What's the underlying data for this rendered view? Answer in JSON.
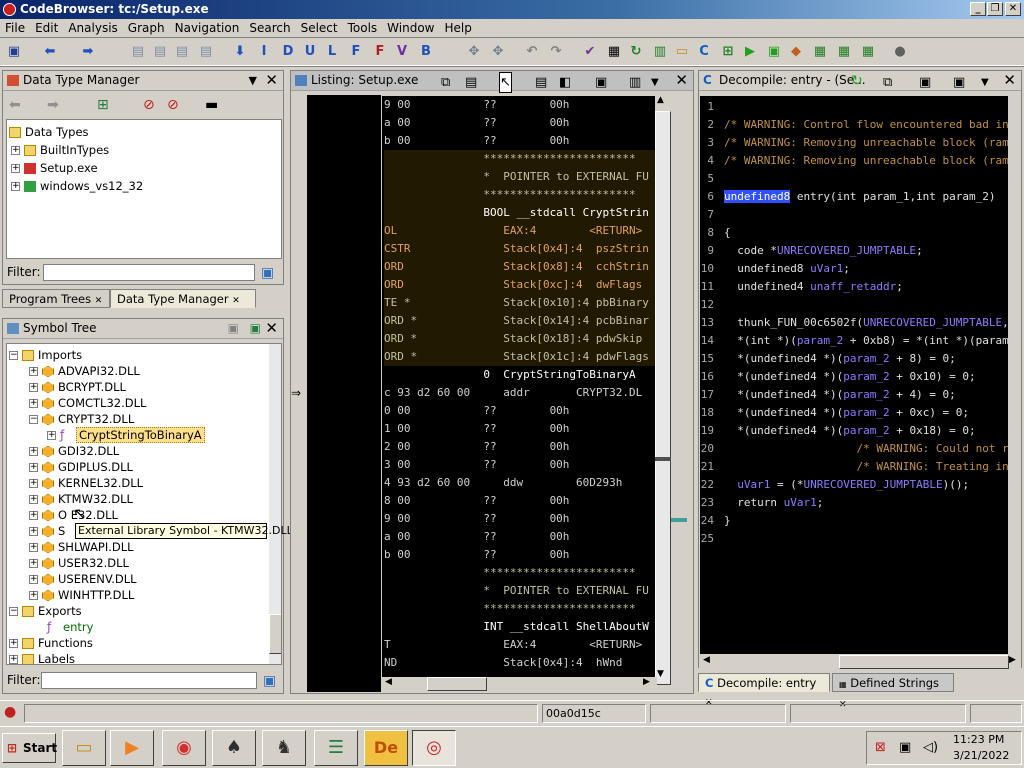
{
  "window": {
    "title": "CodeBrowser: tc:/Setup.exe"
  },
  "menu": [
    "File",
    "Edit",
    "Analysis",
    "Graph",
    "Navigation",
    "Search",
    "Select",
    "Tools",
    "Window",
    "Help"
  ],
  "dtm": {
    "title": "Data Type Manager",
    "root": "Data Types",
    "items": [
      "BuiltInTypes",
      "Setup.exe",
      "windows_vs12_32"
    ],
    "filter_label": "Filter:"
  },
  "left_tabs": [
    "Program Trees",
    "Data Type Manager"
  ],
  "symtree": {
    "title": "Symbol Tree",
    "imports": "Imports",
    "dlls": [
      "ADVAPI32.DLL",
      "BCRYPT.DLL",
      "COMCTL32.DLL",
      "CRYPT32.DLL",
      "GDI32.DLL",
      "GDIPLUS.DLL",
      "KERNEL32.DLL",
      "KTMW32.DLL",
      "OLE32.DLL",
      "S",
      "SHLWAPI.DLL",
      "USER32.DLL",
      "USERENV.DLL",
      "WINHTTP.DLL"
    ],
    "selected_fn": "CryptStringToBinaryA",
    "exports": "Exports",
    "entry": "entry",
    "functions": "Functions",
    "labels": "Labels",
    "filter_label": "Filter:",
    "tooltip": "External Library Symbol - KTMW32.DLL",
    "ole_visible": "O  E32.DLL"
  },
  "listing": {
    "title": "Listing:  Setup.exe",
    "lines": [
      "9 00           ??        00h",
      "a 00           ??        00h",
      "b 00           ??        00h",
      "               ***********************",
      "               *  POINTER to EXTERNAL FU",
      "               ***********************",
      "               BOOL __stdcall CryptStrin",
      "OL                EAX:4        <RETURN>",
      "CSTR              Stack[0x4]:4  pszStrin",
      "ORD               Stack[0x8]:4  cchStrin",
      "ORD               Stack[0xc]:4  dwFlags",
      "TE *              Stack[0x10]:4 pbBinary",
      "ORD *             Stack[0x14]:4 pcbBinar",
      "ORD *             Stack[0x18]:4 pdwSkip",
      "ORD *             Stack[0x1c]:4 pdwFlags",
      "               0  CryptStringToBinaryA",
      "c 93 d2 60 00     addr       CRYPT32.DL",
      "0 00           ??        00h",
      "1 00           ??        00h",
      "2 00           ??        00h",
      "3 00           ??        00h",
      "4 93 d2 60 00     ddw        60D293h",
      "8 00           ??        00h",
      "9 00           ??        00h",
      "a 00           ??        00h",
      "b 00           ??        00h",
      "               ***********************",
      "               *  POINTER to EXTERNAL FU",
      "               ***********************",
      "               INT __stdcall ShellAboutW",
      "T                 EAX:4        <RETURN>",
      "ND                Stack[0x4]:4  hWnd"
    ]
  },
  "decomp": {
    "title": "Decompile: entry -  (Se...",
    "lines": [
      {
        "n": "1",
        "t": ""
      },
      {
        "n": "2",
        "t": "/* WARNING: Control flow encountered bad in"
      },
      {
        "n": "3",
        "t": "/* WARNING: Removing unreachable block (ram"
      },
      {
        "n": "4",
        "t": "/* WARNING: Removing unreachable block (ram"
      },
      {
        "n": "5",
        "t": ""
      },
      {
        "n": "6",
        "t": "undefined8 entry(int param_1,int param_2)"
      },
      {
        "n": "7",
        "t": ""
      },
      {
        "n": "8",
        "t": "{"
      },
      {
        "n": "9",
        "t": "  code *UNRECOVERED_JUMPTABLE;"
      },
      {
        "n": "10",
        "t": "  undefined8 uVar1;"
      },
      {
        "n": "11",
        "t": "  undefined4 unaff_retaddr;"
      },
      {
        "n": "12",
        "t": ""
      },
      {
        "n": "13",
        "t": "  thunk_FUN_00c6502f(UNRECOVERED_JUMPTABLE,"
      },
      {
        "n": "14",
        "t": "  *(int *)(param_2 + 0xb8) = *(int *)(param"
      },
      {
        "n": "15",
        "t": "  *(undefined4 *)(param_2 + 8) = 0;"
      },
      {
        "n": "16",
        "t": "  *(undefined4 *)(param_2 + 0x10) = 0;"
      },
      {
        "n": "17",
        "t": "  *(undefined4 *)(param_2 + 4) = 0;"
      },
      {
        "n": "18",
        "t": "  *(undefined4 *)(param_2 + 0xc) = 0;"
      },
      {
        "n": "19",
        "t": "  *(undefined4 *)(param_2 + 0x18) = 0;"
      },
      {
        "n": "20",
        "t": "                    /* WARNING: Could not r"
      },
      {
        "n": "21",
        "t": "                    /* WARNING: Treating in"
      },
      {
        "n": "22",
        "t": "  uVar1 = (*UNRECOVERED_JUMPTABLE)();"
      },
      {
        "n": "23",
        "t": "  return uVar1;"
      },
      {
        "n": "24",
        "t": "}"
      },
      {
        "n": "25",
        "t": ""
      }
    ]
  },
  "right_tabs": [
    "Decompile: entry",
    "Defined Strings"
  ],
  "status": {
    "address": "00a0d15c"
  },
  "taskbar": {
    "start": "Start",
    "time": "11:23 PM",
    "date": "3/21/2022"
  }
}
